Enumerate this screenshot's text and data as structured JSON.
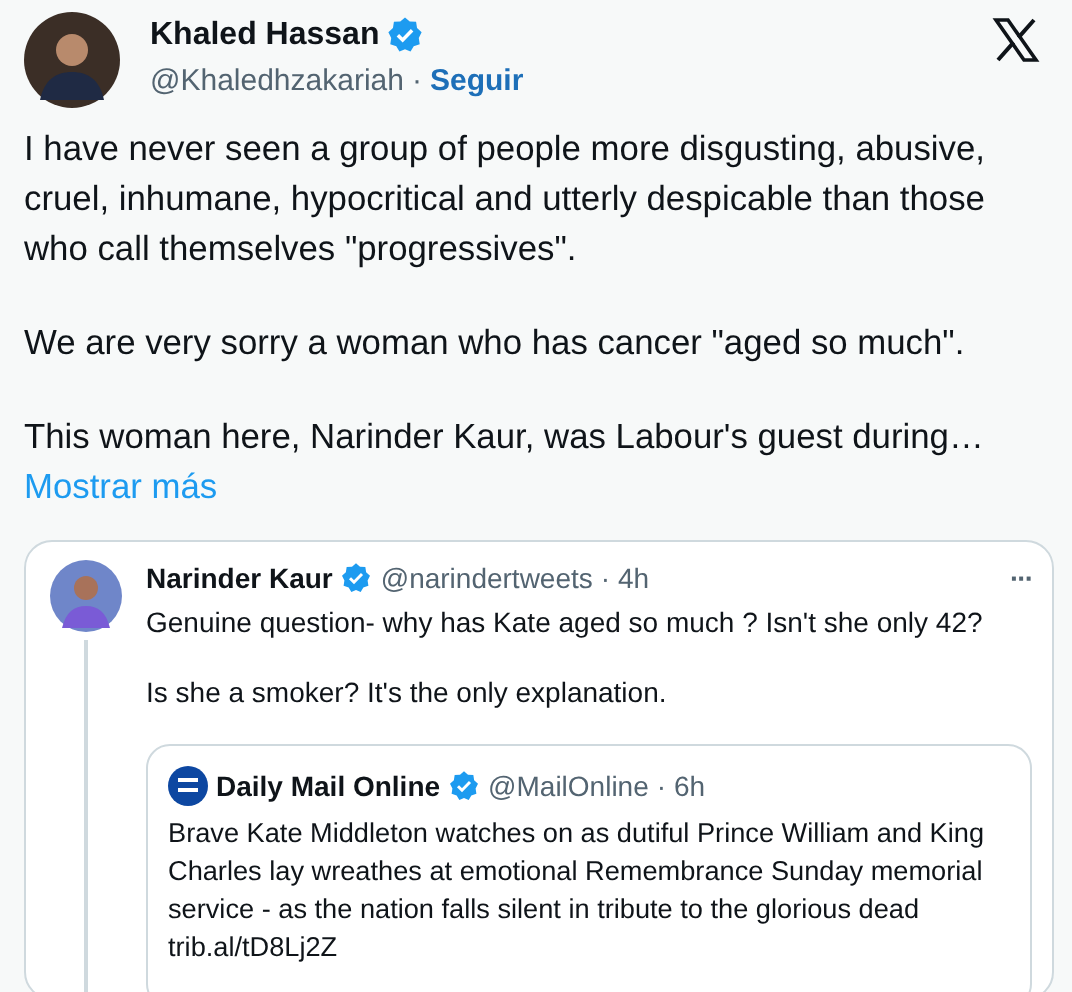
{
  "author": {
    "name": "Khaled Hassan",
    "verified": true,
    "handle": "@Khaledhzakariah",
    "separator": "·",
    "follow": "Seguir"
  },
  "paragraphs": [
    "I have never seen a group of people more disgusting, abusive, cruel, inhumane, hypocritical and utterly despicable than those who call themselves \"progressives\".",
    "We are very sorry a woman who has cancer \"aged so much\".",
    "This woman here, Narinder Kaur, was Labour's guest during…"
  ],
  "show_more": "Mostrar más",
  "quote": {
    "name": "Narinder Kaur",
    "verified": true,
    "handle": "@narindertweets",
    "time": "· 4h",
    "more": "···",
    "paragraphs": [
      "Genuine question- why has Kate aged so much ? Isn't she only 42?",
      "Is she a smoker? It's the only explanation."
    ],
    "quote": {
      "name": "Daily Mail Online",
      "verified": true,
      "handle": "@MailOnline",
      "time": "· 6h",
      "text": "Brave Kate Middleton watches on as dutiful Prince William and King Charles lay wreathes at emotional Remembrance Sunday memorial service - as the nation falls silent in tribute to the glorious dead",
      "link": "trib.al/tD8Lj2Z"
    }
  }
}
